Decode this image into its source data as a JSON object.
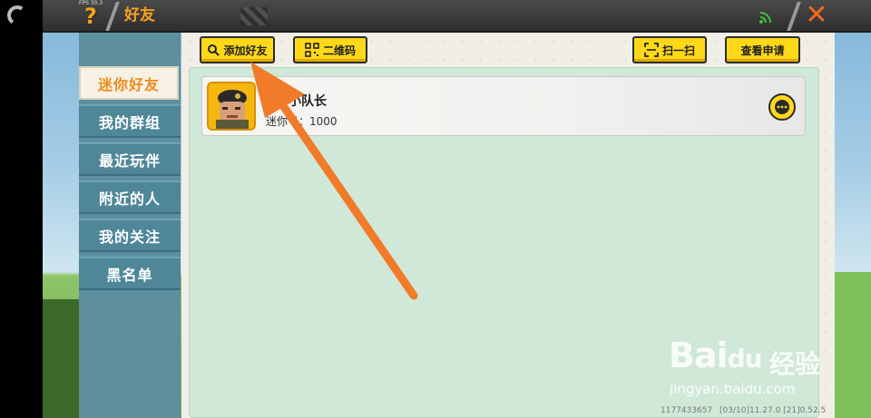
{
  "topbar": {
    "fps": "FPS 30.3",
    "help_glyph": "?",
    "title": "好友",
    "close_glyph": "✕"
  },
  "toolbar": {
    "add_friend": "添加好友",
    "qr_code": "二维码",
    "scan": "扫一扫",
    "view_requests": "查看申请"
  },
  "sidebar": {
    "items": [
      {
        "label": "迷你好友",
        "active": true
      },
      {
        "label": "我的群组",
        "active": false
      },
      {
        "label": "最近玩伴",
        "active": false
      },
      {
        "label": "附近的人",
        "active": false
      },
      {
        "label": "我的关注",
        "active": false
      },
      {
        "label": "黑名单",
        "active": false
      }
    ]
  },
  "friends": [
    {
      "name": "小队长",
      "mini_id_label": "迷你号：",
      "mini_id": "1000"
    }
  ],
  "watermark": {
    "brand": "Bai",
    "brand2": "du",
    "jingyan": "经验",
    "url": "jingyan.baidu.com"
  },
  "footer": {
    "id": "1177433657",
    "info": "[03/10]11.27.0   [21]0.52.5"
  },
  "colors": {
    "accent_yellow": "#ffd81a",
    "title_orange": "#f7a020",
    "sidebar_teal": "#4f8799",
    "content_green": "#d0e8d7",
    "arrow_orange": "#f27b2a"
  }
}
